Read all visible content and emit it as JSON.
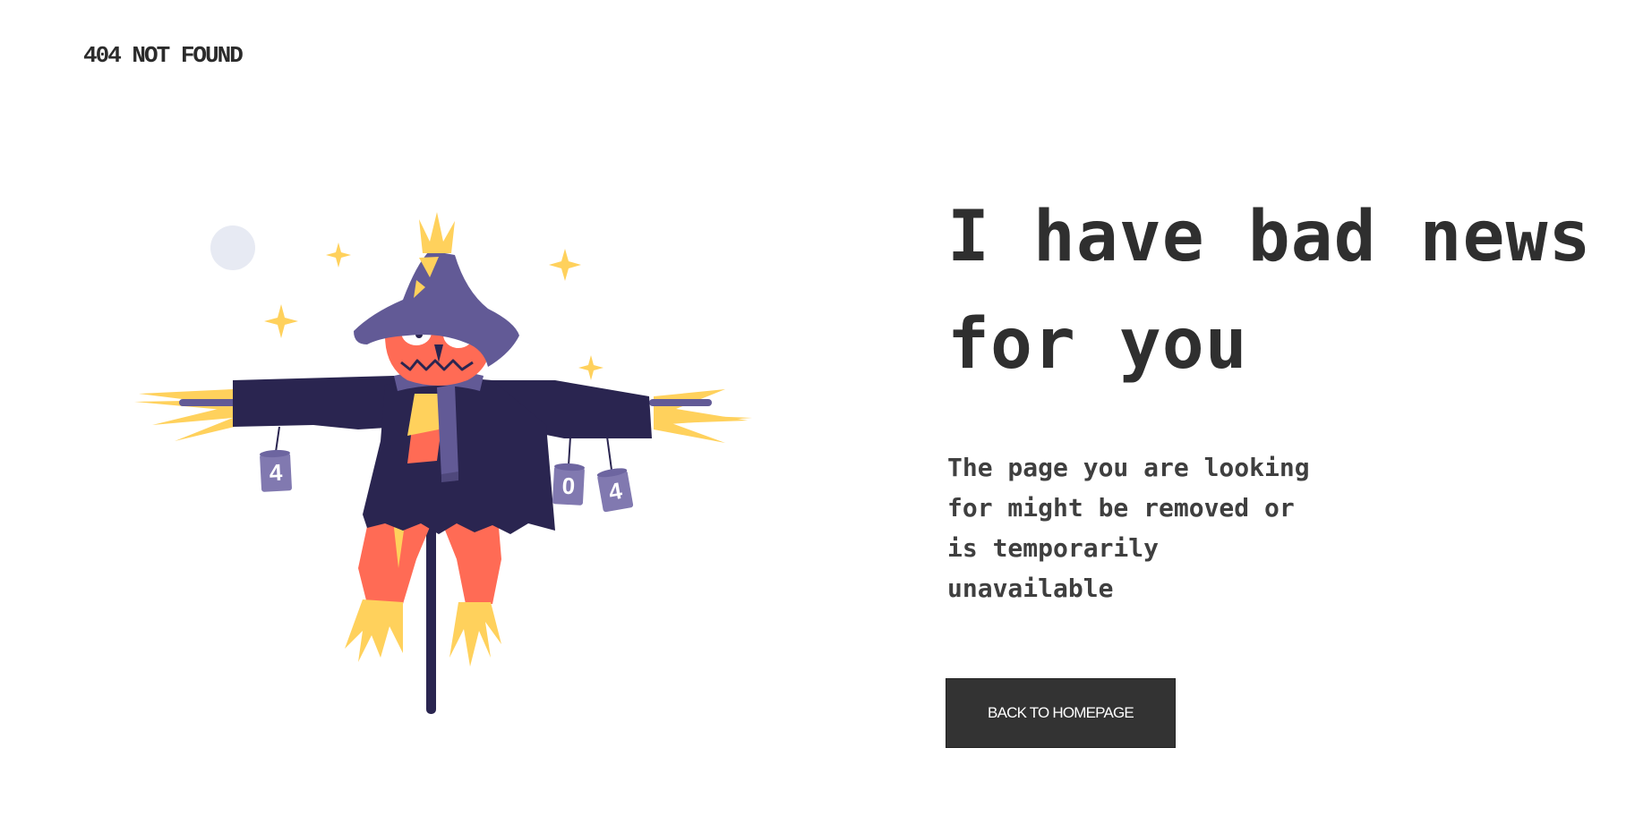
{
  "header": {
    "brand": "404 NOT FOUND"
  },
  "main": {
    "headline": "I have bad news for you",
    "message": "The page you are looking for might be removed or is temporarily unavailable",
    "button_label": "BACK TO HOMEPAGE"
  },
  "illustration": {
    "can_labels": [
      "4",
      "0",
      "4"
    ],
    "colors": {
      "coat": "#2a2550",
      "hat": "#625a96",
      "face": "#ff6b55",
      "straw": "#ffd15c",
      "can": "#8179b0",
      "moon": "#e7eaf3"
    }
  }
}
